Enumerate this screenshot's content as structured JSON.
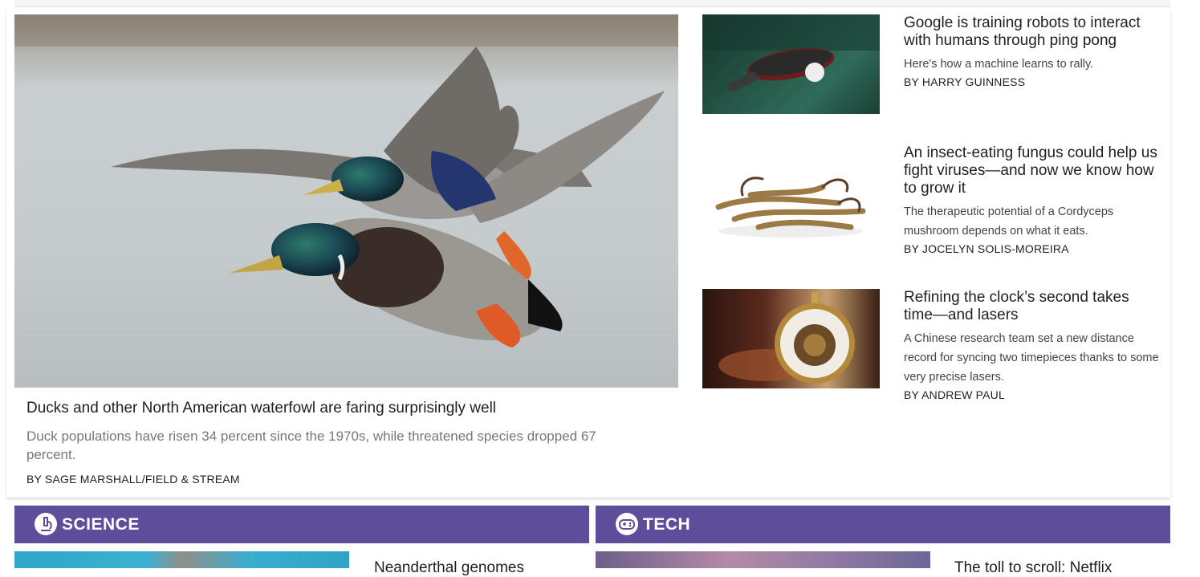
{
  "hero": {
    "title": "Ducks and other North American waterfowl are faring surprisingly well",
    "dek": "Duck populations have risen 34 percent since the 1970s, while threatened species dropped 67 percent.",
    "byline": "BY SAGE MARSHALL/FIELD & STREAM"
  },
  "stories": [
    {
      "title": "Google is training robots to interact with humans through ping pong",
      "dek": "Here's how a machine learns to rally.",
      "byline": "BY HARRY GUINNESS"
    },
    {
      "title": "An insect-eating fungus could help us fight viruses—and now we know how to grow it",
      "dek": "The therapeutic potential of a Cordyceps mushroom depends on what it eats.",
      "byline": "BY JOCELYN SOLIS-MOREIRA"
    },
    {
      "title": "Refining the clock’s second takes time—and lasers",
      "dek": "A Chinese research team set a new distance record for syncing two timepieces thanks to some very precise lasers.",
      "byline": "BY ANDREW PAUL"
    }
  ],
  "sections": [
    {
      "label": "SCIENCE",
      "icon": "microscope-icon",
      "first_story_title": "Neanderthal genomes"
    },
    {
      "label": "TECH",
      "icon": "gamepad-icon",
      "first_story_title": "The toll to scroll: Netflix"
    }
  ],
  "colors": {
    "section_bar": "#5e4d9b"
  }
}
